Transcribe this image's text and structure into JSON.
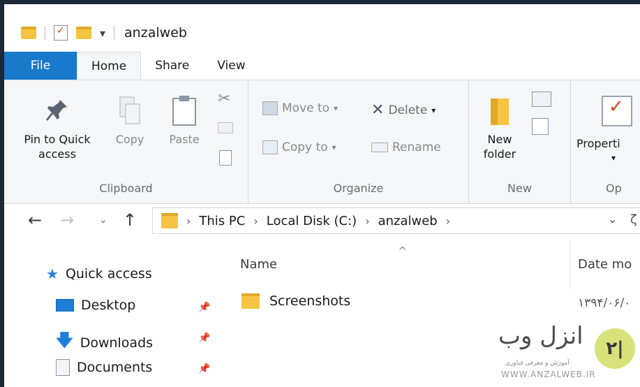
{
  "window": {
    "title": "anzalweb",
    "qat_dropdown": "▾"
  },
  "tabs": [
    {
      "label": "File"
    },
    {
      "label": "Home"
    },
    {
      "label": "Share"
    },
    {
      "label": "View"
    }
  ],
  "ribbon": {
    "clipboard": {
      "label": "Clipboard",
      "pin_line1": "Pin to Quick",
      "pin_line2": "access",
      "copy": "Copy",
      "paste": "Paste"
    },
    "organize": {
      "label": "Organize",
      "move_to": "Move to",
      "copy_to": "Copy to",
      "delete": "Delete",
      "rename": "Rename"
    },
    "new": {
      "label": "New",
      "new_folder_line1": "New",
      "new_folder_line2": "folder"
    },
    "open": {
      "label": "Op",
      "properties": "Properti",
      "properties_dd": "▾"
    }
  },
  "address": {
    "crumbs": [
      "This PC",
      "Local Disk (C:)",
      "anzalweb"
    ],
    "sep": "›",
    "dropdown": "⌄",
    "refresh_partial": "ζ"
  },
  "nav_pane": {
    "quick_access": "Quick access",
    "items": [
      "Desktop",
      "Downloads",
      "Documents"
    ]
  },
  "file_list": {
    "columns": {
      "name": "Name",
      "date": "Date mo"
    },
    "sort_indicator": "^",
    "rows": [
      {
        "name": "Screenshots",
        "date": "۱۳۹۴/۰۶/۰"
      }
    ]
  },
  "watermark": {
    "text": "انزل وب",
    "subtitle": "آموزش و معرفی فناوری",
    "url": "WWW.ANZALWEB.IR",
    "logo_letters": "۲|",
    "accent": "#d8e27a"
  },
  "colors": {
    "file_tab": "#1979ca",
    "folder": "#f5c542",
    "ribbon_bg": "#f5f6f7"
  }
}
